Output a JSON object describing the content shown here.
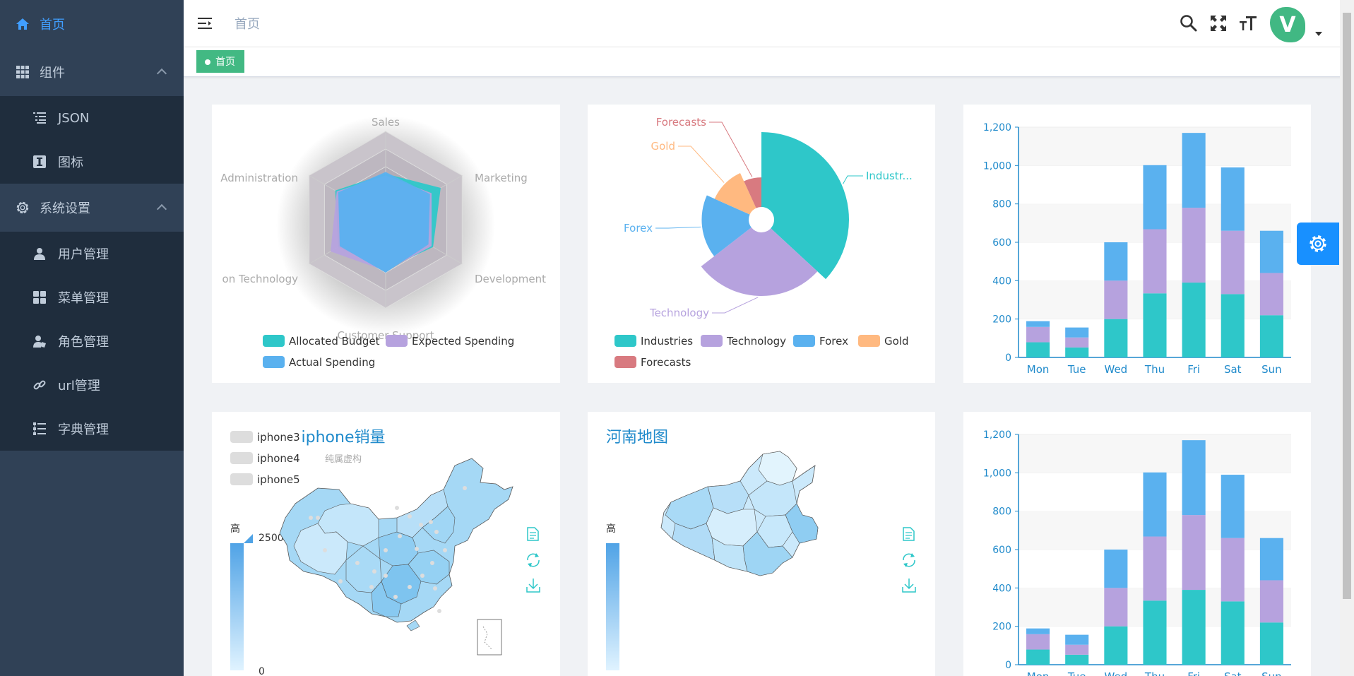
{
  "sidebar": {
    "items": [
      {
        "label": "首页",
        "icon": "home-icon",
        "active": true
      },
      {
        "label": "组件",
        "icon": "grid-icon"
      },
      {
        "label": "系统设置",
        "icon": "gear-icon"
      }
    ],
    "components_sub": [
      {
        "label": "JSON",
        "icon": "list-icon"
      },
      {
        "label": "图标",
        "icon": "icon-icon"
      }
    ],
    "settings_sub": [
      {
        "label": "用户管理",
        "icon": "user-icon"
      },
      {
        "label": "菜单管理",
        "icon": "menu-grid-icon"
      },
      {
        "label": "角色管理",
        "icon": "role-icon"
      },
      {
        "label": "url管理",
        "icon": "link-icon"
      },
      {
        "label": "字典管理",
        "icon": "dictionary-icon"
      }
    ]
  },
  "header": {
    "breadcrumb": "首页",
    "avatar_letter": "V"
  },
  "tags": {
    "active_tag": "首页"
  },
  "colors": {
    "teal": "#2ec7c9",
    "purple": "#b6a2de",
    "blue": "#5ab1ef",
    "orange": "#ffb980",
    "red": "#d87a80",
    "accent": "#409eff",
    "green": "#42b983"
  },
  "chart_data": [
    {
      "type": "radar",
      "indicators": [
        "Sales",
        "Marketing",
        "Development",
        "Customer Support",
        "on Technology",
        "Administration"
      ],
      "series": [
        {
          "name": "Allocated Budget",
          "values": [
            0.52,
            0.72,
            0.62,
            0.56,
            0.62,
            0.66
          ]
        },
        {
          "name": "Expected Spending",
          "values": [
            0.5,
            0.6,
            0.6,
            0.58,
            0.72,
            0.64
          ]
        },
        {
          "name": "Actual Spending",
          "values": [
            0.54,
            0.58,
            0.56,
            0.6,
            0.6,
            0.62
          ]
        }
      ],
      "legend": [
        "Allocated Budget",
        "Expected Spending",
        "Actual Spending"
      ]
    },
    {
      "type": "pie",
      "rose": true,
      "slices": [
        {
          "name": "Industries",
          "value": 320
        },
        {
          "name": "Technology",
          "value": 240
        },
        {
          "name": "Forex",
          "value": 149
        },
        {
          "name": "Gold",
          "value": 100
        },
        {
          "name": "Forecasts",
          "value": 59
        }
      ],
      "labels": [
        "Industr...",
        "Technology",
        "Forex",
        "Gold",
        "Forecasts"
      ],
      "legend": [
        "Industries",
        "Technology",
        "Forex",
        "Gold",
        "Forecasts"
      ]
    },
    {
      "type": "bar",
      "stacked": true,
      "categories": [
        "Mon",
        "Tue",
        "Wed",
        "Thu",
        "Fri",
        "Sat",
        "Sun"
      ],
      "series": [
        {
          "values": [
            79,
            52,
            200,
            334,
            390,
            330,
            220
          ]
        },
        {
          "values": [
            80,
            52,
            200,
            334,
            390,
            330,
            220
          ]
        },
        {
          "values": [
            30,
            52,
            200,
            334,
            390,
            330,
            220
          ]
        }
      ],
      "yticks": [
        "0",
        "200",
        "400",
        "600",
        "800",
        "1,000",
        "1,200"
      ],
      "ylim": [
        0,
        1200
      ]
    },
    {
      "type": "map",
      "title": "iphone销量",
      "subtitle": "纯属虚构",
      "legend": [
        "iphone3",
        "iphone4",
        "iphone5"
      ],
      "visual_map": {
        "high_label": "高",
        "max": "2500",
        "min": "0"
      }
    },
    {
      "type": "map",
      "title": "河南地图",
      "visual_map": {
        "high_label": "高"
      }
    },
    {
      "type": "bar",
      "stacked": true,
      "categories": [
        "Mon",
        "Tue",
        "Wed",
        "Thu",
        "Fri",
        "Sat",
        "Sun"
      ],
      "series": [
        {
          "values": [
            79,
            52,
            200,
            334,
            390,
            330,
            220
          ]
        },
        {
          "values": [
            80,
            52,
            200,
            334,
            390,
            330,
            220
          ]
        },
        {
          "values": [
            30,
            52,
            200,
            334,
            390,
            330,
            220
          ]
        }
      ],
      "yticks": [
        "0",
        "200",
        "400",
        "600",
        "800",
        "1,000",
        "1,200"
      ],
      "ylim": [
        0,
        1200
      ]
    }
  ]
}
